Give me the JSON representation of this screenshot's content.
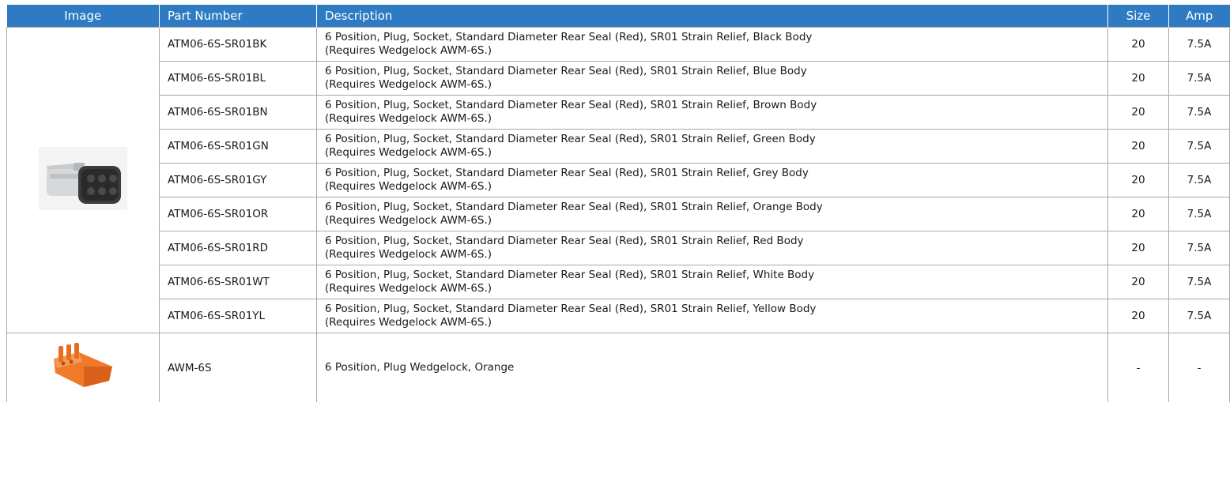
{
  "header": {
    "image": "Image",
    "part_number": "Part Number",
    "description": "Description",
    "size": "Size",
    "amp": "Amp"
  },
  "colors": {
    "header_bg": "#2e7bc4",
    "connector_body": "#d6d8da",
    "connector_face": "#3a3a3a",
    "wedgelock": "#f07a2a"
  },
  "icons": {
    "connector": "atm06-6s-connector-image",
    "wedgelock": "awm-6s-wedgelock-image"
  },
  "rows": [
    {
      "part": "ATM06-6S-SR01BK",
      "desc1": "6 Position, Plug, Socket, Standard Diameter Rear Seal (Red), SR01 Strain Relief, Black Body",
      "desc2": "(Requires Wedgelock AWM-6S.)",
      "size": "20",
      "amp": "7.5A"
    },
    {
      "part": "ATM06-6S-SR01BL",
      "desc1": "6 Position, Plug, Socket, Standard Diameter Rear Seal (Red), SR01 Strain Relief, Blue Body",
      "desc2": "(Requires Wedgelock AWM-6S.)",
      "size": "20",
      "amp": "7.5A"
    },
    {
      "part": "ATM06-6S-SR01BN",
      "desc1": "6 Position, Plug, Socket, Standard Diameter Rear Seal (Red), SR01 Strain Relief, Brown Body",
      "desc2": "(Requires Wedgelock AWM-6S.)",
      "size": "20",
      "amp": "7.5A"
    },
    {
      "part": "ATM06-6S-SR01GN",
      "desc1": "6 Position, Plug, Socket, Standard Diameter Rear Seal (Red), SR01 Strain Relief, Green Body",
      "desc2": "(Requires Wedgelock AWM-6S.)",
      "size": "20",
      "amp": "7.5A"
    },
    {
      "part": "ATM06-6S-SR01GY",
      "desc1": "6 Position, Plug, Socket, Standard Diameter Rear Seal (Red), SR01 Strain Relief, Grey Body",
      "desc2": "(Requires Wedgelock AWM-6S.)",
      "size": "20",
      "amp": "7.5A"
    },
    {
      "part": "ATM06-6S-SR01OR",
      "desc1": "6 Position, Plug, Socket, Standard Diameter Rear Seal (Red), SR01 Strain Relief, Orange Body",
      "desc2": "(Requires Wedgelock AWM-6S.)",
      "size": "20",
      "amp": "7.5A"
    },
    {
      "part": "ATM06-6S-SR01RD",
      "desc1": "6 Position, Plug, Socket, Standard Diameter Rear Seal (Red), SR01 Strain Relief, Red Body",
      "desc2": "(Requires Wedgelock AWM-6S.)",
      "size": "20",
      "amp": "7.5A"
    },
    {
      "part": "ATM06-6S-SR01WT",
      "desc1": "6 Position, Plug, Socket, Standard Diameter Rear Seal (Red), SR01 Strain Relief, White Body",
      "desc2": "(Requires Wedgelock AWM-6S.)",
      "size": "20",
      "amp": "7.5A"
    },
    {
      "part": "ATM06-6S-SR01YL",
      "desc1": "6 Position, Plug, Socket, Standard Diameter Rear Seal (Red), SR01 Strain Relief, Yellow Body",
      "desc2": "(Requires Wedgelock AWM-6S.)",
      "size": "20",
      "amp": "7.5A"
    },
    {
      "part": "AWM-6S",
      "desc1": "6 Position, Plug Wedgelock, Orange",
      "desc2": "",
      "size": "-",
      "amp": "-"
    }
  ]
}
